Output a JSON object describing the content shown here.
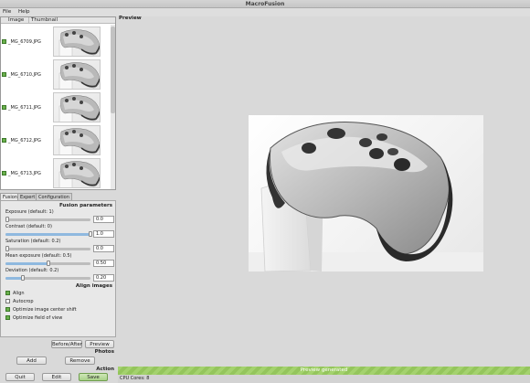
{
  "window": {
    "title": "MacroFusion"
  },
  "menu": {
    "file": "File",
    "help": "Help"
  },
  "image_list": {
    "col_image": "Image",
    "col_thumbnail": "Thumbnail",
    "rows": [
      {
        "name": "_MG_6709.JPG",
        "checked": true
      },
      {
        "name": "_MG_6710.JPG",
        "checked": true
      },
      {
        "name": "_MG_6711.JPG",
        "checked": true
      },
      {
        "name": "_MG_6712.JPG",
        "checked": true
      },
      {
        "name": "_MG_6713.JPG",
        "checked": true
      }
    ]
  },
  "tabs": {
    "fusion": "Fusion",
    "expert": "Expert",
    "configuration": "Configuration"
  },
  "fusion": {
    "section_title": "Fusion parameters",
    "exposure": {
      "label": "Exposure (default: 1)",
      "value": "0.0",
      "level": 0.0
    },
    "contrast": {
      "label": "Contrast (default: 0)",
      "value": "1.0",
      "level": 1.0
    },
    "saturation": {
      "label": "Saturation (default: 0.2)",
      "value": "0.0",
      "level": 0.0
    },
    "mu": {
      "label": "Mean exposure (default: 0.5)",
      "value": "0.50",
      "level": 0.5
    },
    "sigma": {
      "label": "Deviation (default: 0.2)",
      "value": "0.20",
      "level": 0.2
    }
  },
  "align": {
    "section_title": "Align images",
    "align": {
      "label": "Align",
      "checked": true
    },
    "autocrop": {
      "label": "Autocrop",
      "checked": false
    },
    "center_shift": {
      "label": "Optimize image center shift",
      "checked": true
    },
    "field_of_view": {
      "label": "Optimize field of view",
      "checked": true
    }
  },
  "buttons": {
    "before_after": "Before/After",
    "preview": "Preview",
    "add": "Add",
    "remove": "Remove",
    "quit": "Quit",
    "edit": "Edit",
    "save": "Save"
  },
  "sections": {
    "photos": "Photos",
    "action": "Action",
    "preview": "Preview"
  },
  "status": {
    "progress_text": "Preview generated",
    "progress": 1.0,
    "cpu": "CPU Cores: 8"
  },
  "colors": {
    "accent": "#a4d26e"
  }
}
